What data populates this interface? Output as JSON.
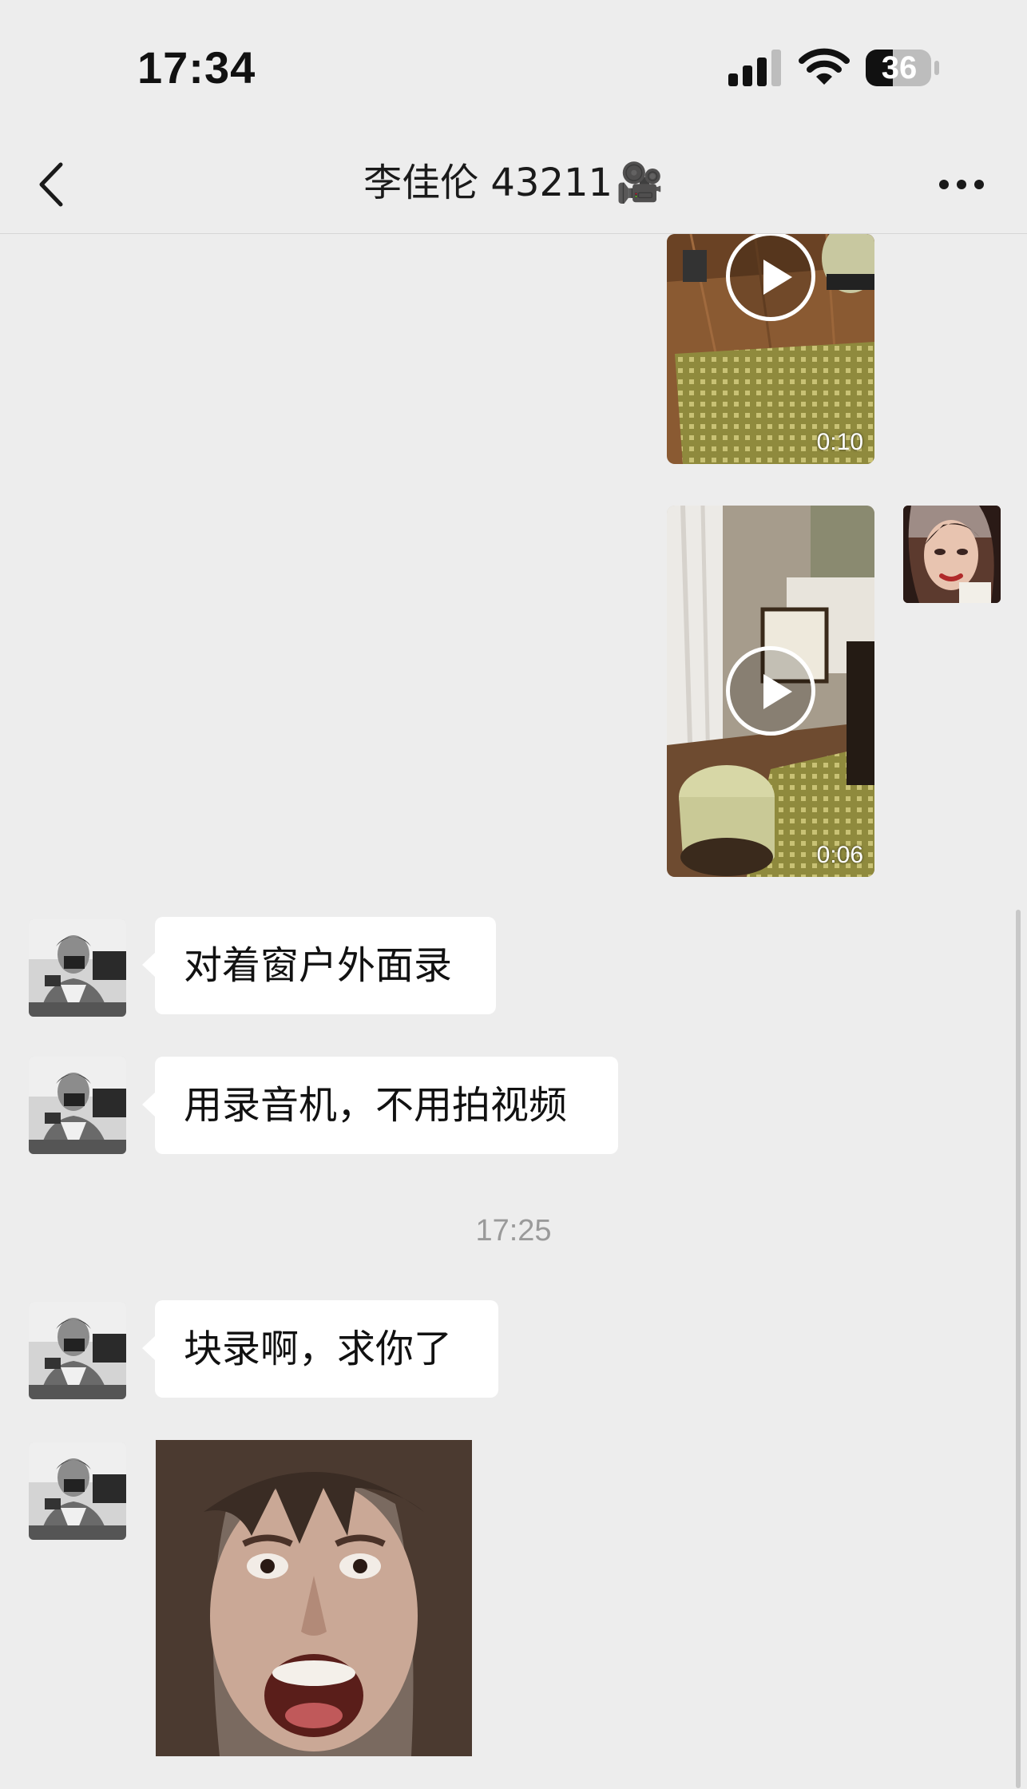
{
  "status_bar": {
    "time": "17:34",
    "battery": "36",
    "icons": [
      "signal-icon",
      "wifi-icon",
      "battery-icon"
    ]
  },
  "nav": {
    "title": "李佳伦 43211",
    "title_emoji": "🎥",
    "back_icon": "chevron-left-icon",
    "more_icon": "more-horizontal-icon"
  },
  "messages": [
    {
      "sender": "me",
      "type": "video",
      "duration": "0:10"
    },
    {
      "sender": "me",
      "type": "video",
      "duration": "0:06"
    },
    {
      "sender": "other",
      "type": "text",
      "text": "对着窗户外面录"
    },
    {
      "sender": "other",
      "type": "text",
      "text": "用录音机，不用拍视频"
    },
    {
      "type": "timestamp",
      "text": "17:25"
    },
    {
      "sender": "other",
      "type": "text",
      "text": "块录啊，求你了"
    },
    {
      "sender": "other",
      "type": "sticker"
    }
  ],
  "colors": {
    "background": "#ededed",
    "bubble_other": "#ffffff",
    "timestamp": "#9a9a9a"
  }
}
